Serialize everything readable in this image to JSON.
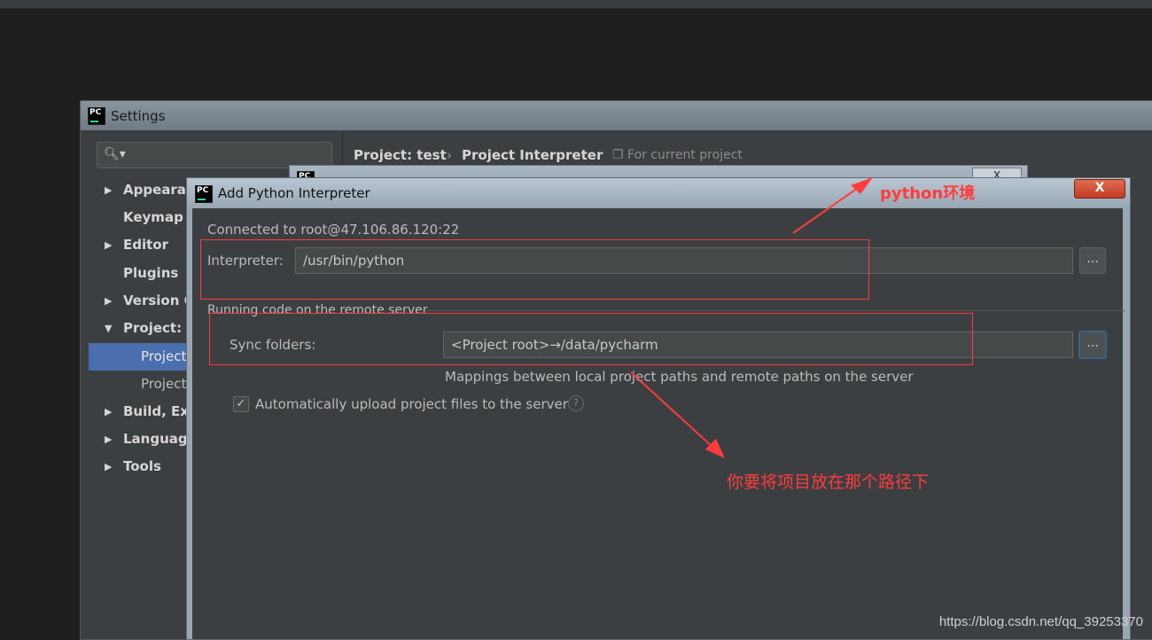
{
  "settings": {
    "title": "Settings",
    "logo_text": "PC",
    "search_icon": "search-icon",
    "breadcrumb": {
      "project": "Project: test",
      "separator": "›",
      "page": "Project Interpreter",
      "note": "For current project"
    },
    "nav": [
      {
        "label": "Appearan",
        "arrow": "▶"
      },
      {
        "label": "Keymap",
        "arrow": ""
      },
      {
        "label": "Editor",
        "arrow": "▶"
      },
      {
        "label": "Plugins",
        "arrow": ""
      },
      {
        "label": "Version C",
        "arrow": "▶"
      },
      {
        "label": "Project: t",
        "arrow": "▼"
      },
      {
        "label": "Project",
        "arrow": ""
      },
      {
        "label": "Project",
        "arrow": ""
      },
      {
        "label": "Build, Exe",
        "arrow": "▶"
      },
      {
        "label": "Language",
        "arrow": "▶"
      },
      {
        "label": "Tools",
        "arrow": "▶"
      }
    ]
  },
  "background_dialog": {
    "close_label": "X"
  },
  "dialog": {
    "title": "Add Python Interpreter",
    "logo_text": "PC",
    "close_label": "X",
    "connected": "Connected to root@47.106.86.120:22",
    "interpreter_label": "Interpreter:",
    "interpreter_value": "/usr/bin/python",
    "browse_label": "...",
    "section_title": "Running code on the remote server",
    "sync_label": "Sync folders:",
    "sync_value": "<Project root>→/data/pycharm",
    "mappings_hint": "Mappings between local project paths and remote paths on the server",
    "auto_upload_label": "Automatically upload project files to the server",
    "auto_upload_checked": "✓",
    "help_label": "?"
  },
  "annotations": {
    "python_env": "python环境",
    "path_note": "你要将项目放在那个路径下",
    "color": "#ff3b3b"
  },
  "watermark": "https://blog.csdn.net/qq_39253370"
}
